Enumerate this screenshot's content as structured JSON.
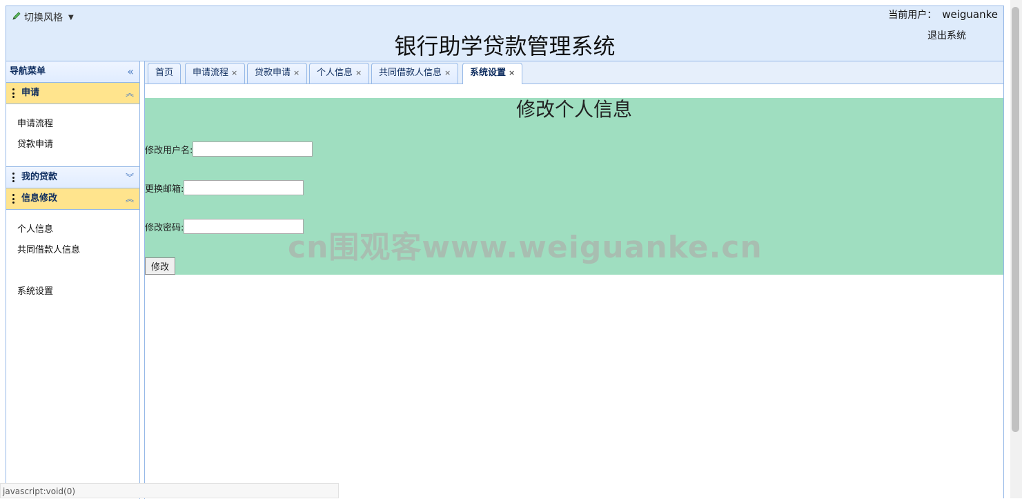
{
  "header": {
    "theme_switch": "切换风格",
    "title": "银行助学贷款管理系统",
    "current_user_label": "当前用户：",
    "username": "weiguanke",
    "logout": "退出系统"
  },
  "sidebar": {
    "title": "导航菜单",
    "panels": [
      {
        "title": "申请",
        "items": [
          "申请流程",
          "贷款申请"
        ]
      },
      {
        "title": "我的贷款",
        "items": []
      },
      {
        "title": "信息修改",
        "items": [
          "个人信息",
          "共同借款人信息",
          "系统设置"
        ]
      }
    ]
  },
  "tabs": [
    "首页",
    "申请流程",
    "贷款申请",
    "个人信息",
    "共同借款人信息",
    "系统设置"
  ],
  "tab_close": "×",
  "form": {
    "title": "修改个人信息",
    "username_label": "修改用户名:",
    "email_label": "更换邮箱:",
    "password_label": "修改密码:",
    "submit": "修改"
  },
  "watermark": "cn围观客www.weiguanke.cn",
  "status_bar": "javascript:void(0)",
  "colors": {
    "header_bg": "#deebfb",
    "active_panel": "#ffe48d",
    "form_bg": "#9fdec0",
    "border": "#95b8e7"
  }
}
